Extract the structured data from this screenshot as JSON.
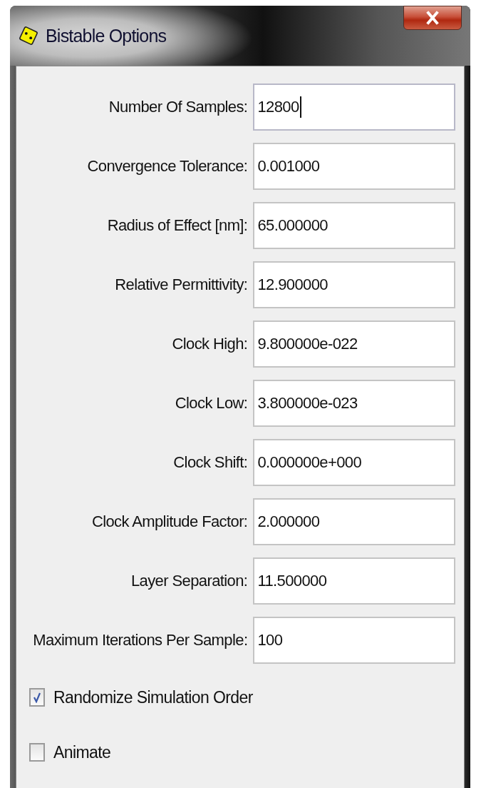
{
  "window": {
    "title": "Bistable Options"
  },
  "fields": [
    {
      "label": "Number Of Samples:",
      "value": "12800",
      "focused": true
    },
    {
      "label": "Convergence Tolerance:",
      "value": "0.001000",
      "focused": false
    },
    {
      "label": "Radius of Effect [nm]:",
      "value": "65.000000",
      "focused": false
    },
    {
      "label": "Relative Permittivity:",
      "value": "12.900000",
      "focused": false
    },
    {
      "label": "Clock High:",
      "value": "9.800000e-022",
      "focused": false
    },
    {
      "label": "Clock Low:",
      "value": "3.800000e-023",
      "focused": false
    },
    {
      "label": "Clock Shift:",
      "value": "0.000000e+000",
      "focused": false
    },
    {
      "label": "Clock Amplitude Factor:",
      "value": "2.000000",
      "focused": false
    },
    {
      "label": "Layer Separation:",
      "value": "11.500000",
      "focused": false
    },
    {
      "label": "Maximum Iterations Per Sample:",
      "value": "100",
      "focused": false
    }
  ],
  "checkboxes": [
    {
      "label": "Randomize Simulation Order",
      "checked": true
    },
    {
      "label": "Animate",
      "checked": false
    }
  ]
}
